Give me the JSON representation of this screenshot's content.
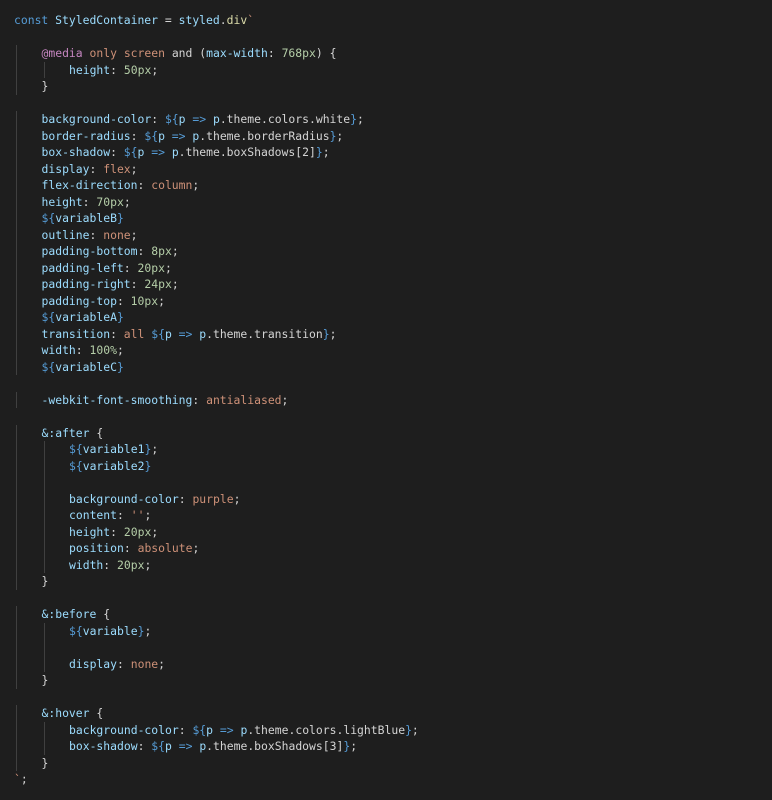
{
  "colors": {
    "background": "#1e1e1e",
    "default": "#d4d4d4",
    "keyword": "#569cd6",
    "variable": "#9cdcfe",
    "function": "#dcdcaa",
    "string": "#ce9178",
    "number": "#b5cea8",
    "punctuation": "#d4d4d4",
    "template": "#569cd6",
    "property": "#9cdcfe",
    "value": "#ce9178",
    "at_rule": "#c586c0",
    "indent_guide": "#404040"
  },
  "code_lines": [
    {
      "indent": 0,
      "tokens": [
        [
          "const ",
          "keyword"
        ],
        [
          "StyledContainer",
          "variable"
        ],
        [
          " = ",
          "default"
        ],
        [
          "styled",
          "variable"
        ],
        [
          ".",
          "default"
        ],
        [
          "div",
          "function"
        ],
        [
          "`",
          "string"
        ]
      ]
    },
    {
      "indent": 0,
      "tokens": []
    },
    {
      "indent": 1,
      "tokens": [
        [
          "@media",
          "at_rule"
        ],
        [
          " ",
          "default"
        ],
        [
          "only",
          "value"
        ],
        [
          " ",
          "default"
        ],
        [
          "screen",
          "value"
        ],
        [
          " and (",
          "default"
        ],
        [
          "max-width",
          "property"
        ],
        [
          ": ",
          "default"
        ],
        [
          "768px",
          "number"
        ],
        [
          ") {",
          "default"
        ]
      ]
    },
    {
      "indent": 2,
      "tokens": [
        [
          "height",
          "property"
        ],
        [
          ": ",
          "default"
        ],
        [
          "50px",
          "number"
        ],
        [
          ";",
          "default"
        ]
      ]
    },
    {
      "indent": 1,
      "tokens": [
        [
          "}",
          "default"
        ]
      ]
    },
    {
      "indent": 0,
      "tokens": []
    },
    {
      "indent": 1,
      "tokens": [
        [
          "background-color",
          "property"
        ],
        [
          ": ",
          "default"
        ],
        [
          "${",
          "template"
        ],
        [
          "p",
          "variable"
        ],
        [
          " => ",
          "keyword"
        ],
        [
          "p",
          "variable"
        ],
        [
          ".theme.colors.white",
          "default"
        ],
        [
          "}",
          "template"
        ],
        [
          ";",
          "default"
        ]
      ]
    },
    {
      "indent": 1,
      "tokens": [
        [
          "border-radius",
          "property"
        ],
        [
          ": ",
          "default"
        ],
        [
          "${",
          "template"
        ],
        [
          "p",
          "variable"
        ],
        [
          " => ",
          "keyword"
        ],
        [
          "p",
          "variable"
        ],
        [
          ".theme.borderRadius",
          "default"
        ],
        [
          "}",
          "template"
        ],
        [
          ";",
          "default"
        ]
      ]
    },
    {
      "indent": 1,
      "tokens": [
        [
          "box-shadow",
          "property"
        ],
        [
          ": ",
          "default"
        ],
        [
          "${",
          "template"
        ],
        [
          "p",
          "variable"
        ],
        [
          " => ",
          "keyword"
        ],
        [
          "p",
          "variable"
        ],
        [
          ".theme.boxShadows[2]",
          "default"
        ],
        [
          "}",
          "template"
        ],
        [
          ";",
          "default"
        ]
      ]
    },
    {
      "indent": 1,
      "tokens": [
        [
          "display",
          "property"
        ],
        [
          ": ",
          "default"
        ],
        [
          "flex",
          "value"
        ],
        [
          ";",
          "default"
        ]
      ]
    },
    {
      "indent": 1,
      "tokens": [
        [
          "flex-direction",
          "property"
        ],
        [
          ": ",
          "default"
        ],
        [
          "column",
          "value"
        ],
        [
          ";",
          "default"
        ]
      ]
    },
    {
      "indent": 1,
      "tokens": [
        [
          "height",
          "property"
        ],
        [
          ": ",
          "default"
        ],
        [
          "70px",
          "number"
        ],
        [
          ";",
          "default"
        ]
      ]
    },
    {
      "indent": 1,
      "tokens": [
        [
          "${",
          "template"
        ],
        [
          "variableB",
          "variable"
        ],
        [
          "}",
          "template"
        ]
      ]
    },
    {
      "indent": 1,
      "tokens": [
        [
          "outline",
          "property"
        ],
        [
          ": ",
          "default"
        ],
        [
          "none",
          "value"
        ],
        [
          ";",
          "default"
        ]
      ]
    },
    {
      "indent": 1,
      "tokens": [
        [
          "padding-bottom",
          "property"
        ],
        [
          ": ",
          "default"
        ],
        [
          "8px",
          "number"
        ],
        [
          ";",
          "default"
        ]
      ]
    },
    {
      "indent": 1,
      "tokens": [
        [
          "padding-left",
          "property"
        ],
        [
          ": ",
          "default"
        ],
        [
          "20px",
          "number"
        ],
        [
          ";",
          "default"
        ]
      ]
    },
    {
      "indent": 1,
      "tokens": [
        [
          "padding-right",
          "property"
        ],
        [
          ": ",
          "default"
        ],
        [
          "24px",
          "number"
        ],
        [
          ";",
          "default"
        ]
      ]
    },
    {
      "indent": 1,
      "tokens": [
        [
          "padding-top",
          "property"
        ],
        [
          ": ",
          "default"
        ],
        [
          "10px",
          "number"
        ],
        [
          ";",
          "default"
        ]
      ]
    },
    {
      "indent": 1,
      "tokens": [
        [
          "${",
          "template"
        ],
        [
          "variableA",
          "variable"
        ],
        [
          "}",
          "template"
        ]
      ]
    },
    {
      "indent": 1,
      "tokens": [
        [
          "transition",
          "property"
        ],
        [
          ": ",
          "default"
        ],
        [
          "all",
          "value"
        ],
        [
          " ",
          "default"
        ],
        [
          "${",
          "template"
        ],
        [
          "p",
          "variable"
        ],
        [
          " => ",
          "keyword"
        ],
        [
          "p",
          "variable"
        ],
        [
          ".theme.transition",
          "default"
        ],
        [
          "}",
          "template"
        ],
        [
          ";",
          "default"
        ]
      ]
    },
    {
      "indent": 1,
      "tokens": [
        [
          "width",
          "property"
        ],
        [
          ": ",
          "default"
        ],
        [
          "100%",
          "number"
        ],
        [
          ";",
          "default"
        ]
      ]
    },
    {
      "indent": 1,
      "tokens": [
        [
          "${",
          "template"
        ],
        [
          "variableC",
          "variable"
        ],
        [
          "}",
          "template"
        ]
      ]
    },
    {
      "indent": 0,
      "tokens": []
    },
    {
      "indent": 1,
      "tokens": [
        [
          "-webkit-font-smoothing",
          "property"
        ],
        [
          ": ",
          "default"
        ],
        [
          "antialiased",
          "value"
        ],
        [
          ";",
          "default"
        ]
      ]
    },
    {
      "indent": 0,
      "tokens": []
    },
    {
      "indent": 1,
      "tokens": [
        [
          "&:after",
          "property"
        ],
        [
          " {",
          "default"
        ]
      ]
    },
    {
      "indent": 2,
      "tokens": [
        [
          "${",
          "template"
        ],
        [
          "variable1",
          "variable"
        ],
        [
          "}",
          "template"
        ],
        [
          ";",
          "default"
        ]
      ]
    },
    {
      "indent": 2,
      "tokens": [
        [
          "${",
          "template"
        ],
        [
          "variable2",
          "variable"
        ],
        [
          "}",
          "template"
        ]
      ]
    },
    {
      "indent": 0,
      "tokens": [],
      "guides": 2
    },
    {
      "indent": 2,
      "tokens": [
        [
          "background-color",
          "property"
        ],
        [
          ": ",
          "default"
        ],
        [
          "purple",
          "value"
        ],
        [
          ";",
          "default"
        ]
      ]
    },
    {
      "indent": 2,
      "tokens": [
        [
          "content",
          "property"
        ],
        [
          ": ",
          "default"
        ],
        [
          "''",
          "string"
        ],
        [
          ";",
          "default"
        ]
      ]
    },
    {
      "indent": 2,
      "tokens": [
        [
          "height",
          "property"
        ],
        [
          ": ",
          "default"
        ],
        [
          "20px",
          "number"
        ],
        [
          ";",
          "default"
        ]
      ]
    },
    {
      "indent": 2,
      "tokens": [
        [
          "position",
          "property"
        ],
        [
          ": ",
          "default"
        ],
        [
          "absolute",
          "value"
        ],
        [
          ";",
          "default"
        ]
      ]
    },
    {
      "indent": 2,
      "tokens": [
        [
          "width",
          "property"
        ],
        [
          ": ",
          "default"
        ],
        [
          "20px",
          "number"
        ],
        [
          ";",
          "default"
        ]
      ]
    },
    {
      "indent": 1,
      "tokens": [
        [
          "}",
          "default"
        ]
      ]
    },
    {
      "indent": 0,
      "tokens": []
    },
    {
      "indent": 1,
      "tokens": [
        [
          "&:before",
          "property"
        ],
        [
          " {",
          "default"
        ]
      ]
    },
    {
      "indent": 2,
      "tokens": [
        [
          "${",
          "template"
        ],
        [
          "variable",
          "variable"
        ],
        [
          "}",
          "template"
        ],
        [
          ";",
          "default"
        ]
      ]
    },
    {
      "indent": 0,
      "tokens": [],
      "guides": 2
    },
    {
      "indent": 2,
      "tokens": [
        [
          "display",
          "property"
        ],
        [
          ": ",
          "default"
        ],
        [
          "none",
          "value"
        ],
        [
          ";",
          "default"
        ]
      ]
    },
    {
      "indent": 1,
      "tokens": [
        [
          "}",
          "default"
        ]
      ]
    },
    {
      "indent": 0,
      "tokens": []
    },
    {
      "indent": 1,
      "tokens": [
        [
          "&:hover",
          "property"
        ],
        [
          " {",
          "default"
        ]
      ]
    },
    {
      "indent": 2,
      "tokens": [
        [
          "background-color",
          "property"
        ],
        [
          ": ",
          "default"
        ],
        [
          "${",
          "template"
        ],
        [
          "p",
          "variable"
        ],
        [
          " => ",
          "keyword"
        ],
        [
          "p",
          "variable"
        ],
        [
          ".theme.colors.lightBlue",
          "default"
        ],
        [
          "}",
          "template"
        ],
        [
          ";",
          "default"
        ]
      ]
    },
    {
      "indent": 2,
      "tokens": [
        [
          "box-shadow",
          "property"
        ],
        [
          ": ",
          "default"
        ],
        [
          "${",
          "template"
        ],
        [
          "p",
          "variable"
        ],
        [
          " => ",
          "keyword"
        ],
        [
          "p",
          "variable"
        ],
        [
          ".theme.boxShadows[3]",
          "default"
        ],
        [
          "}",
          "template"
        ],
        [
          ";",
          "default"
        ]
      ]
    },
    {
      "indent": 1,
      "tokens": [
        [
          "}",
          "default"
        ]
      ]
    },
    {
      "indent": 0,
      "tokens": [
        [
          "`",
          "string"
        ],
        [
          ";",
          "default"
        ]
      ]
    }
  ]
}
